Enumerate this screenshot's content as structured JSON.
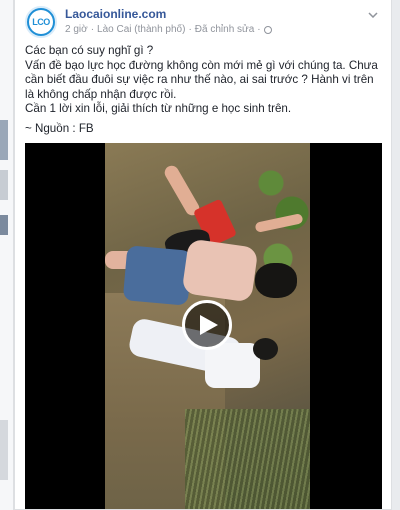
{
  "post": {
    "page_name": "Laocaionline.com",
    "avatar_text": "LCO",
    "time": "2 giờ",
    "location": "Lào Cai (thành phố)",
    "edited": "Đã chỉnh sửa",
    "separator": "·",
    "lines": [
      "Các bạn có suy nghĩ gì ?",
      "Vấn đề bạo lực học đường không còn mới mẻ gì với chúng ta. Chưa cần biết đầu đuôi sự việc ra như thế nào, ai sai trước ? Hành vi trên là không chấp nhận được rồi.",
      "Cần 1 lời xin lỗi, giải thích từ những e học sinh trên.",
      "~ Nguồn : FB"
    ]
  },
  "icons": {
    "avatar": "page-logo",
    "globe": "globe-icon",
    "menu": "chevron-down-icon",
    "play": "play-icon"
  }
}
